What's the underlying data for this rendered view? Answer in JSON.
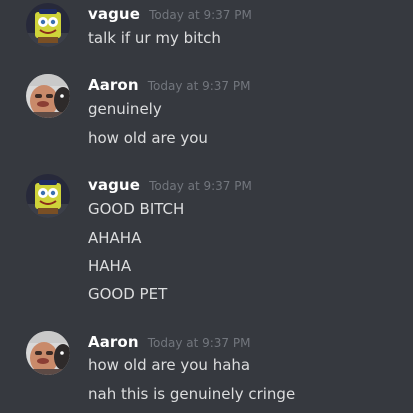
{
  "messages": [
    {
      "author": "vague",
      "timestamp": "Today at 9:37 PM",
      "avatar_icon": "spongebob-avatar",
      "lines": [
        "talk if ur my bitch"
      ]
    },
    {
      "author": "Aaron",
      "timestamp": "Today at 9:37 PM",
      "avatar_icon": "man-with-dog-avatar",
      "lines": [
        "genuinely",
        "how old are you"
      ]
    },
    {
      "author": "vague",
      "timestamp": "Today at 9:37 PM",
      "avatar_icon": "spongebob-avatar",
      "lines": [
        "GOOD BITCH",
        "AHAHA",
        "HAHA",
        "GOOD PET"
      ]
    },
    {
      "author": "Aaron",
      "timestamp": "Today at 9:37 PM",
      "avatar_icon": "man-with-dog-avatar",
      "lines": [
        "how old are you haha",
        "nah this is genuinely cringe"
      ]
    }
  ],
  "colors": {
    "background": "#36393f",
    "username": "#ffffff",
    "timestamp": "#72767d",
    "message_text": "#dcddde"
  }
}
